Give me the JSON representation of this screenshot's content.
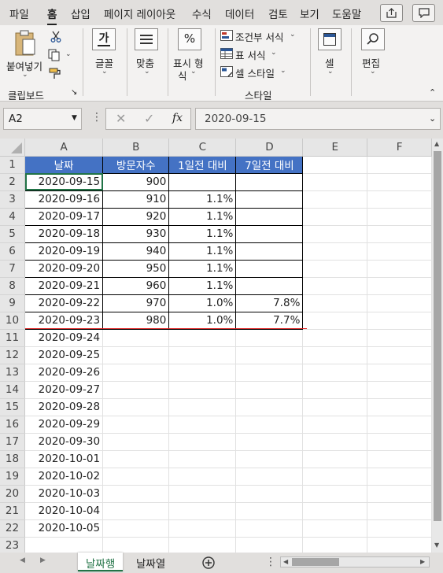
{
  "ribbon_tabs": [
    "파일",
    "홈",
    "삽입",
    "페이지 레이아웃",
    "수식",
    "데이터",
    "검토",
    "보기",
    "도움말"
  ],
  "active_tab": "홈",
  "clipboard": {
    "paste_label": "붙여넣기",
    "group_label": "클립보드"
  },
  "font_group": {
    "label": "글꼴",
    "icon_text": "가"
  },
  "align_group": {
    "label": "맞춤"
  },
  "number_group": {
    "label1": "표시 형",
    "label2": "식",
    "icon_text": "%"
  },
  "style_group": {
    "items": [
      "조건부 서식",
      "표 서식",
      "셀 스타일"
    ],
    "label": "스타일"
  },
  "cells_group": {
    "label": "셀"
  },
  "edit_group": {
    "label": "편집"
  },
  "formula_bar": {
    "name_box": "A2",
    "fx": "fx",
    "value": "2020-09-15"
  },
  "columns": [
    "A",
    "B",
    "C",
    "D",
    "E",
    "F"
  ],
  "header_row": [
    "날짜",
    "방문자수",
    "1일전 대비",
    "7일전 대비"
  ],
  "rows": [
    {
      "n": "2",
      "date": "2020-09-15",
      "visits": "900",
      "d1": "",
      "d7": ""
    },
    {
      "n": "3",
      "date": "2020-09-16",
      "visits": "910",
      "d1": "1.1%",
      "d7": ""
    },
    {
      "n": "4",
      "date": "2020-09-17",
      "visits": "920",
      "d1": "1.1%",
      "d7": ""
    },
    {
      "n": "5",
      "date": "2020-09-18",
      "visits": "930",
      "d1": "1.1%",
      "d7": ""
    },
    {
      "n": "6",
      "date": "2020-09-19",
      "visits": "940",
      "d1": "1.1%",
      "d7": ""
    },
    {
      "n": "7",
      "date": "2020-09-20",
      "visits": "950",
      "d1": "1.1%",
      "d7": ""
    },
    {
      "n": "8",
      "date": "2020-09-21",
      "visits": "960",
      "d1": "1.1%",
      "d7": ""
    },
    {
      "n": "9",
      "date": "2020-09-22",
      "visits": "970",
      "d1": "1.0%",
      "d7": "7.8%"
    },
    {
      "n": "10",
      "date": "2020-09-23",
      "visits": "980",
      "d1": "1.0%",
      "d7": "7.7%"
    },
    {
      "n": "11",
      "date": "2020-09-24",
      "visits": "",
      "d1": "",
      "d7": ""
    },
    {
      "n": "12",
      "date": "2020-09-25",
      "visits": "",
      "d1": "",
      "d7": ""
    },
    {
      "n": "13",
      "date": "2020-09-26",
      "visits": "",
      "d1": "",
      "d7": ""
    },
    {
      "n": "14",
      "date": "2020-09-27",
      "visits": "",
      "d1": "",
      "d7": ""
    },
    {
      "n": "15",
      "date": "2020-09-28",
      "visits": "",
      "d1": "",
      "d7": ""
    },
    {
      "n": "16",
      "date": "2020-09-29",
      "visits": "",
      "d1": "",
      "d7": ""
    },
    {
      "n": "17",
      "date": "2020-09-30",
      "visits": "",
      "d1": "",
      "d7": ""
    },
    {
      "n": "18",
      "date": "2020-10-01",
      "visits": "",
      "d1": "",
      "d7": ""
    },
    {
      "n": "19",
      "date": "2020-10-02",
      "visits": "",
      "d1": "",
      "d7": ""
    },
    {
      "n": "20",
      "date": "2020-10-03",
      "visits": "",
      "d1": "",
      "d7": ""
    },
    {
      "n": "21",
      "date": "2020-10-04",
      "visits": "",
      "d1": "",
      "d7": ""
    },
    {
      "n": "22",
      "date": "2020-10-05",
      "visits": "",
      "d1": "",
      "d7": ""
    }
  ],
  "header_row_number": "1",
  "last_row_number": "23",
  "sheet_tabs": [
    "날짜행",
    "날짜열"
  ],
  "active_sheet": "날짜행",
  "colors": {
    "header_fill": "#4472c4",
    "accent": "#217346",
    "red_line": "#e02020"
  }
}
